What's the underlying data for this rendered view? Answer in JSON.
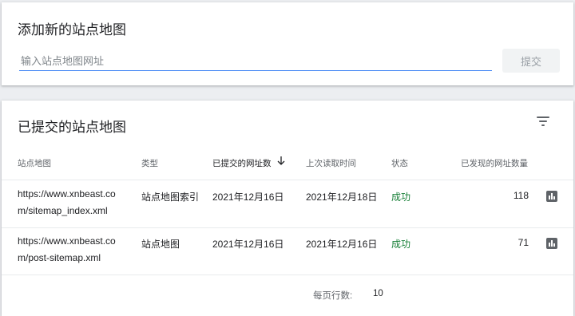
{
  "add_sitemap": {
    "title": "添加新的站点地图",
    "input_placeholder": "输入站点地图网址",
    "submit_label": "提交"
  },
  "submitted": {
    "title": "已提交的站点地图",
    "filter_icon": "filter-icon",
    "columns": {
      "sitemap": "站点地图",
      "type": "类型",
      "submitted_date": "已提交的网址数",
      "last_read": "上次读取时间",
      "status": "状态",
      "discovered_urls": "已发现的网址数量"
    },
    "sort_icon": "arrow-down-icon",
    "rows": [
      {
        "url_line1": "https://www.xnbeast.co",
        "url_line2": "m/sitemap_index.xml",
        "type": "站点地图索引",
        "submitted": "2021年12月16日",
        "last_read": "2021年12月18日",
        "status": "成功",
        "discovered": "118",
        "icon": "bar-chart-icon"
      },
      {
        "url_line1": "https://www.xnbeast.co",
        "url_line2": "m/post-sitemap.xml",
        "type": "站点地图",
        "submitted": "2021年12月16日",
        "last_read": "2021年12月16日",
        "status": "成功",
        "discovered": "71",
        "icon": "bar-chart-icon"
      }
    ],
    "pagination": {
      "rows_per_page_label": "每页行数:",
      "rows_per_page_value": "10"
    }
  },
  "colors": {
    "accent": "#4285f4",
    "success": "#188038",
    "background": "#eceef1"
  }
}
